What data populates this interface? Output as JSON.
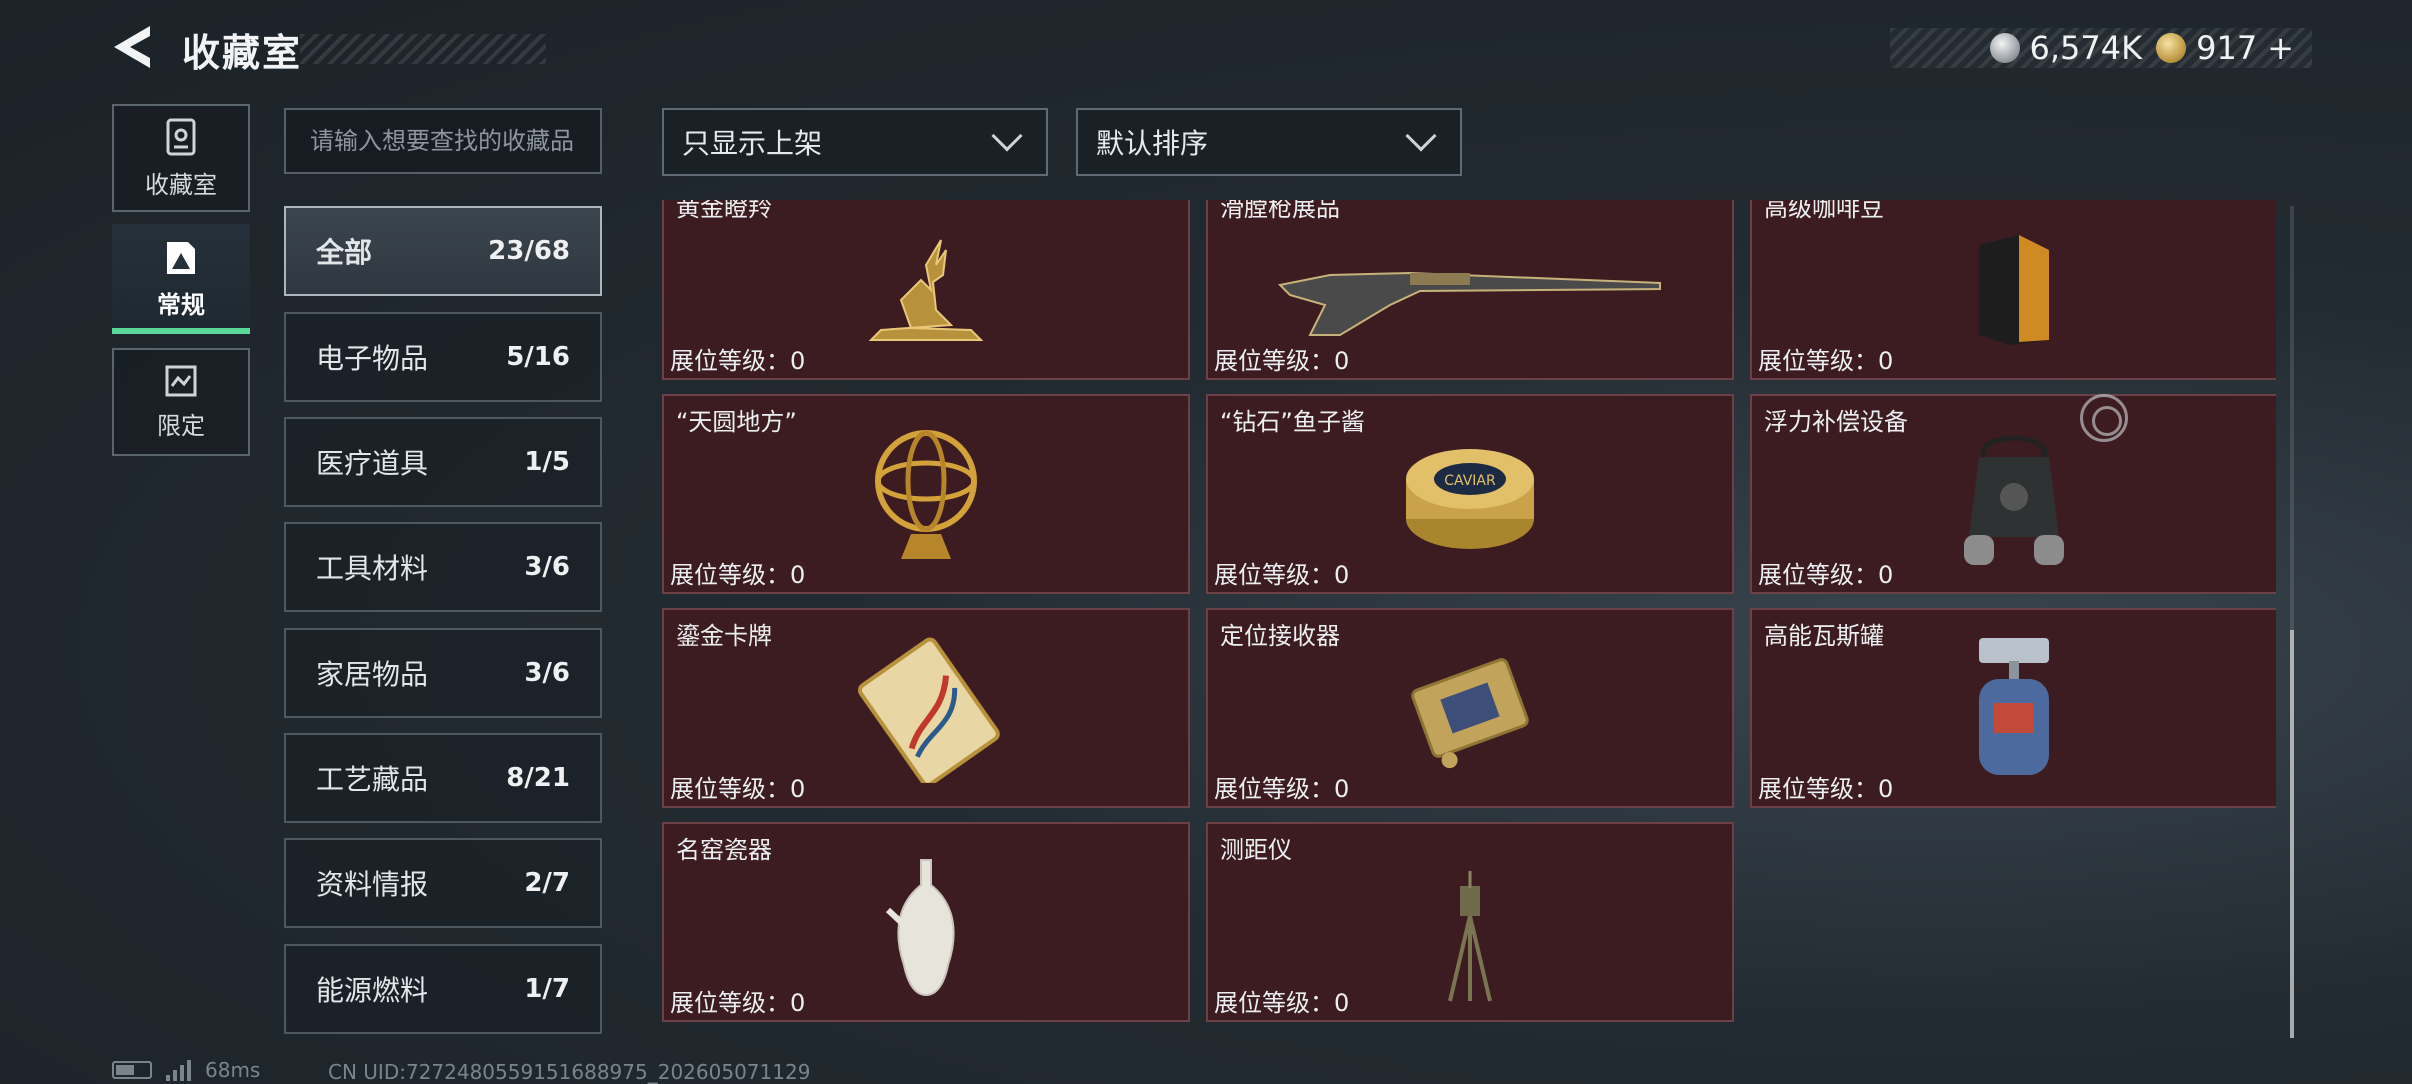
{
  "header": {
    "title": "收藏室",
    "currency": [
      {
        "icon": "silver-coin-icon",
        "value": "6,574K"
      },
      {
        "icon": "gold-coin-icon",
        "value": "917"
      }
    ],
    "add_label": "+"
  },
  "rail": [
    {
      "label": "收藏室",
      "icon": "collection-room-icon"
    },
    {
      "label": "常规",
      "icon": "regular-icon",
      "active": true
    },
    {
      "label": "限定",
      "icon": "limited-icon"
    }
  ],
  "search": {
    "placeholder": "请输入想要查找的收藏品"
  },
  "filters": {
    "show_filter": "只显示上架",
    "sort": "默认排序"
  },
  "categories": [
    {
      "name": "全部",
      "count": "23/68",
      "active": true
    },
    {
      "name": "电子物品",
      "count": "5/16"
    },
    {
      "name": "医疗道具",
      "count": "1/5"
    },
    {
      "name": "工具材料",
      "count": "3/6"
    },
    {
      "name": "家居物品",
      "count": "3/6"
    },
    {
      "name": "工艺藏品",
      "count": "8/21"
    },
    {
      "name": "资料情报",
      "count": "2/7"
    },
    {
      "name": "能源燃料",
      "count": "1/7"
    }
  ],
  "items": [
    {
      "name": "黄金瞪羚",
      "level": "展位等级：0",
      "icon": "gazelle-statue-icon"
    },
    {
      "name": "滑膛枪展品",
      "level": "展位等级：0",
      "icon": "musket-icon"
    },
    {
      "name": "高级咖啡豆",
      "level": "展位等级：0",
      "icon": "coffee-bag-icon"
    },
    {
      "name": "“天圆地方”",
      "level": "展位等级：0",
      "icon": "armillary-sphere-icon"
    },
    {
      "name": "“钻石”鱼子酱",
      "level": "展位等级：0",
      "icon": "caviar-tin-icon"
    },
    {
      "name": "浮力补偿设备",
      "level": "展位等级：0",
      "icon": "buoyancy-device-icon"
    },
    {
      "name": "鎏金卡牌",
      "level": "展位等级：0",
      "icon": "gilded-card-icon"
    },
    {
      "name": "定位接收器",
      "level": "展位等级：0",
      "icon": "locator-receiver-icon"
    },
    {
      "name": "高能瓦斯罐",
      "level": "展位等级：0",
      "icon": "gas-canister-icon"
    },
    {
      "name": "名窑瓷器",
      "level": "展位等级：0",
      "icon": "porcelain-vase-icon"
    },
    {
      "name": "测距仪",
      "level": "展位等级：0",
      "icon": "rangefinder-icon"
    }
  ],
  "caviar_label": "CAVIAR",
  "status": {
    "ping": "68ms",
    "uid": "CN UID:7272480559151688975_202605071129"
  }
}
